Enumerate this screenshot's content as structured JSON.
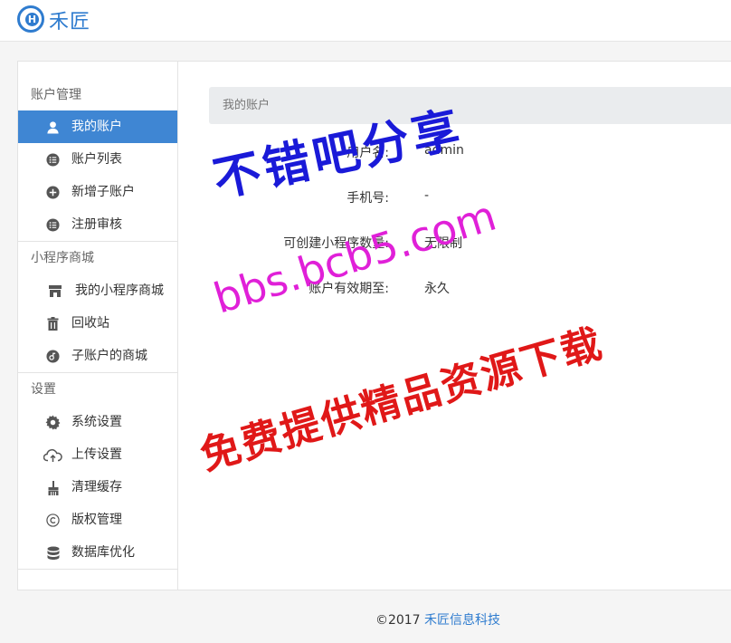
{
  "brand": {
    "logo_letter": "H",
    "name": "禾匠"
  },
  "sidebar": {
    "groups": [
      {
        "title": "账户管理",
        "items": [
          {
            "label": "我的账户",
            "icon": "user-icon",
            "active": true
          },
          {
            "label": "账户列表",
            "icon": "list-icon"
          },
          {
            "label": "新增子账户",
            "icon": "plus-circle-icon"
          },
          {
            "label": "注册审核",
            "icon": "list-icon"
          }
        ]
      },
      {
        "title": "小程序商城",
        "items": [
          {
            "label": "我的小程序商城",
            "icon": "store-icon"
          },
          {
            "label": "回收站",
            "icon": "trash-icon"
          },
          {
            "label": "子账户的商城",
            "icon": "link-circle-icon"
          }
        ]
      },
      {
        "title": "设置",
        "items": [
          {
            "label": "系统设置",
            "icon": "gear-icon"
          },
          {
            "label": "上传设置",
            "icon": "cloud-upload-icon"
          },
          {
            "label": "清理缓存",
            "icon": "broom-icon"
          },
          {
            "label": "版权管理",
            "icon": "copyright-icon"
          },
          {
            "label": "数据库优化",
            "icon": "database-icon"
          }
        ]
      }
    ]
  },
  "main": {
    "breadcrumb": "我的账户",
    "fields": [
      {
        "label": "用户名:",
        "value": "admin"
      },
      {
        "label": "手机号:",
        "value": "-"
      },
      {
        "label": "可创建小程序数量:",
        "value": "无限制"
      },
      {
        "label": "账户有效期至:",
        "value": "永久"
      }
    ]
  },
  "footer": {
    "copyright": "©2017",
    "company": "禾匠信息科技"
  },
  "watermarks": {
    "line1": "不错吧分享",
    "line2": "bbs.bcb5.com",
    "line3": "免费提供精品资源下载"
  },
  "colors": {
    "accent": "#3f86d3",
    "brand": "#2f7ccf"
  }
}
